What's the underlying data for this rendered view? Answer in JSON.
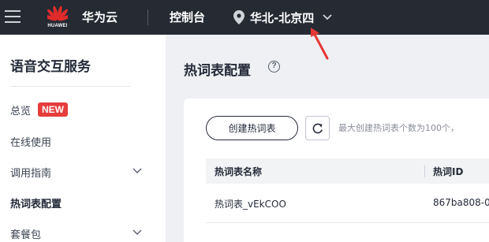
{
  "topbar": {
    "logo_text": "HUAWEI",
    "brand": "华为云",
    "console": "控制台",
    "region": "华北-北京四",
    "menu_icon": "hamburger-menu-icon",
    "region_icon": "location-pin-icon",
    "background": "#252a33"
  },
  "sidebar": {
    "title": "语音交互服务",
    "items": [
      {
        "label": "总览",
        "badge": "NEW"
      },
      {
        "label": "在线使用"
      },
      {
        "label": "调用指南",
        "expandable": true
      },
      {
        "label": "热词表配置",
        "active": true
      },
      {
        "label": "套餐包",
        "expandable": true
      }
    ]
  },
  "main": {
    "page_title": "热词表配置",
    "help_icon": "?",
    "create_button": "创建热词表",
    "refresh_icon": "refresh-icon",
    "hint": "最大创建热词表个数为100个，",
    "table": {
      "columns": [
        "热词表名称",
        "热词ID"
      ],
      "rows": [
        [
          "热词表_vEkCOO",
          "867ba808-0"
        ]
      ]
    }
  },
  "colors": {
    "badge": "#e63c3c",
    "annotation_arrow": "#e53935"
  }
}
